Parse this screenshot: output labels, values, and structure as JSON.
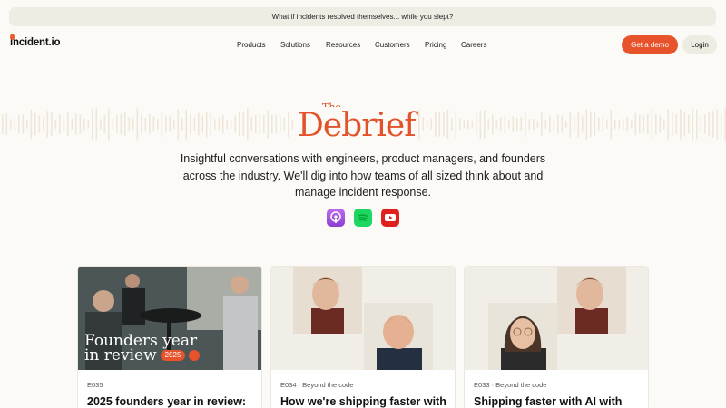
{
  "announcement": "What if incidents resolved themselves... while you slept?",
  "logo": "incident.io",
  "menu": [
    "Products",
    "Solutions",
    "Resources",
    "Customers",
    "Pricing",
    "Careers"
  ],
  "buttons": {
    "demo": "Get a demo",
    "login": "Login"
  },
  "brand": {
    "the": "The",
    "name": "Debrief"
  },
  "intro": "Insightful conversations with engineers, product managers, and founders across the industry. We'll dig into how teams of all sized think about and manage incident response.",
  "podcasts": [
    "apple-podcasts-icon",
    "spotify-icon",
    "youtube-icon"
  ],
  "cards": [
    {
      "episode": "E035",
      "title": "2025 founders year in review:",
      "overlay_line1": "Founders year",
      "overlay_line2": "in review",
      "overlay_badge": "2025"
    },
    {
      "episode": "E034 · Beyond the code",
      "title": "How we're shipping faster with"
    },
    {
      "episode": "E033 · Beyond the code",
      "title": "Shipping faster with AI with"
    }
  ],
  "colors": {
    "accent": "#e8532c",
    "background": "#fbfaf6"
  }
}
